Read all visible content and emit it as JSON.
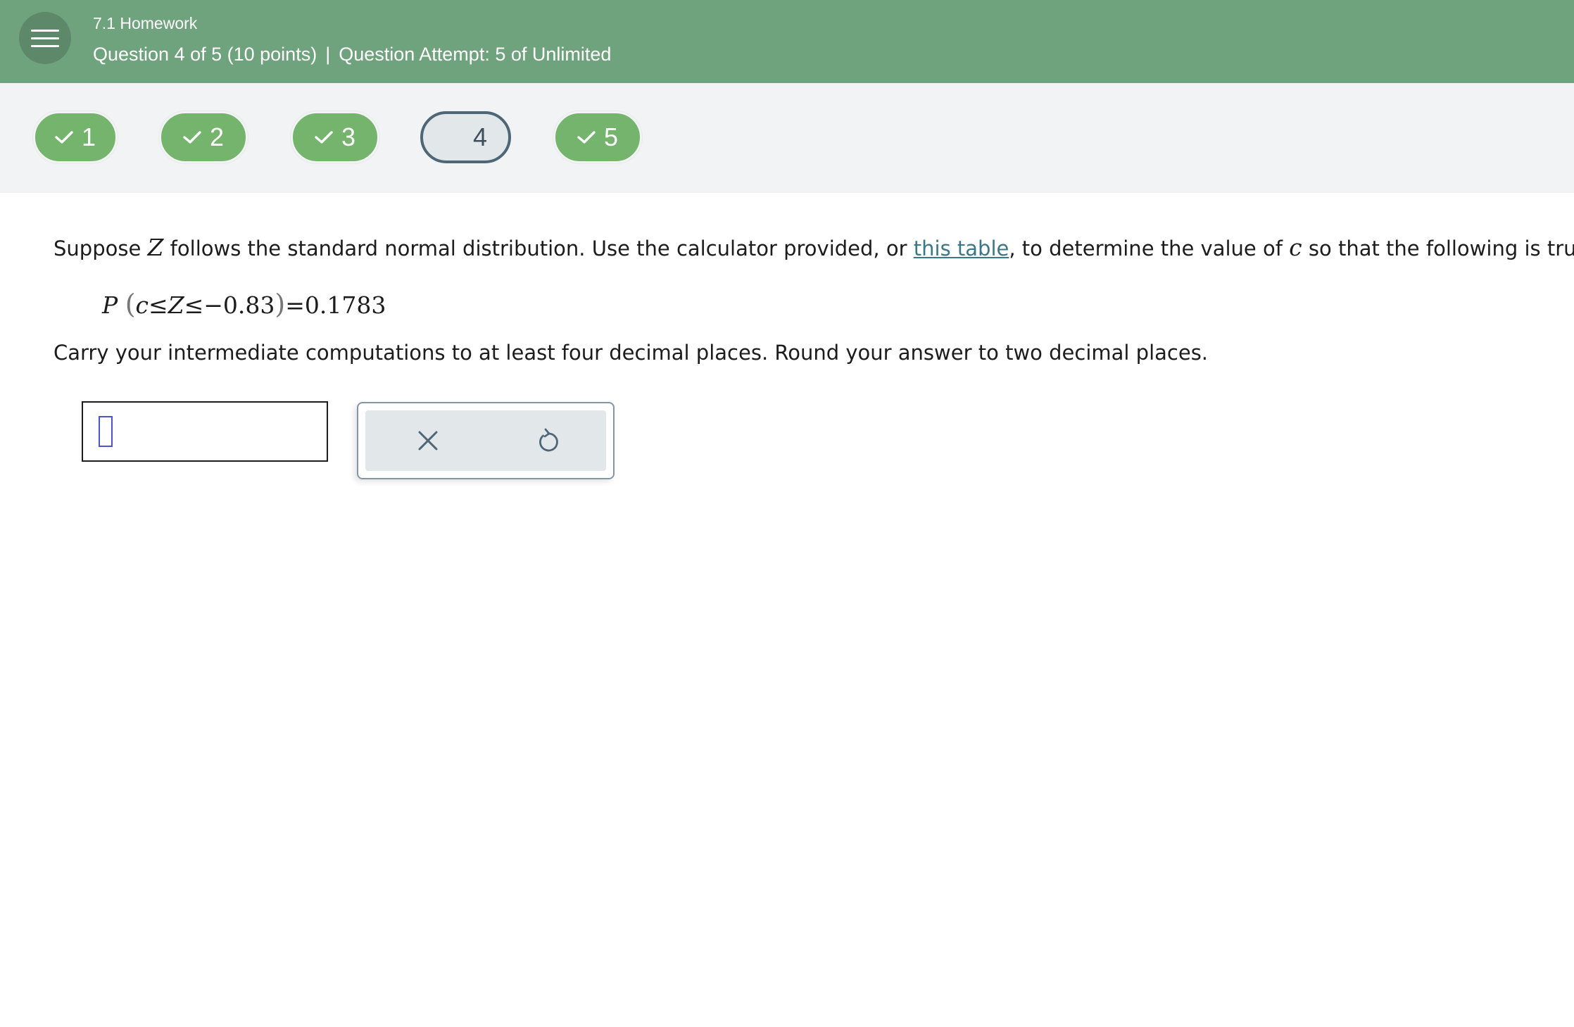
{
  "header": {
    "assignment_title": "7.1 Homework",
    "question_info": "Question 4 of 5 (10 points)",
    "separator": "|",
    "attempt_info": "Question Attempt: 5 of Unlimited",
    "background_color": "#6fa37e"
  },
  "question_nav": [
    {
      "label": "1",
      "status": "complete"
    },
    {
      "label": "2",
      "status": "complete"
    },
    {
      "label": "3",
      "status": "complete"
    },
    {
      "label": "4",
      "status": "current"
    },
    {
      "label": "5",
      "status": "complete"
    }
  ],
  "question": {
    "text_before_z": "Suppose ",
    "var_z": "Z",
    "text_after_z": " follows the standard normal distribution. Use the calculator provided, or ",
    "link_text": "this table",
    "text_after_link": ", to determine the value of ",
    "var_c": "c",
    "text_end": " so that the following is true.",
    "formula": {
      "p": "P",
      "open_paren": "(",
      "c": "c",
      "le1": "≤",
      "z": "Z",
      "le2": "≤",
      "value": "−0.83",
      "close_paren": ")",
      "equals": "=",
      "probability": "0.1783"
    },
    "instruction": "Carry your intermediate computations to at least four decimal places. Round your answer to two decimal places."
  },
  "answer": {
    "value": ""
  },
  "tools": {
    "clear_icon": "close-icon",
    "undo_icon": "undo-icon"
  }
}
